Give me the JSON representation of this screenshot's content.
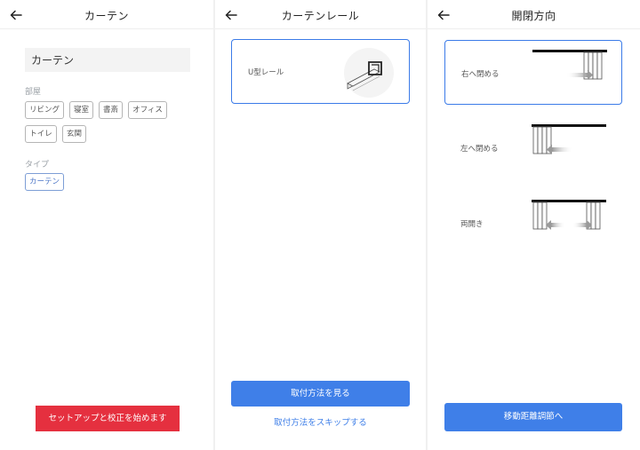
{
  "screen1": {
    "title": "カーテン",
    "name_value": "カーテン",
    "room_label": "部屋",
    "rooms": [
      "リビング",
      "寝室",
      "書斎",
      "オフィス",
      "トイレ",
      "玄関"
    ],
    "type_label": "タイプ",
    "type_selected": "カーテン",
    "start_button": "セットアップと校正を始めます"
  },
  "screen2": {
    "title": "カーテンレール",
    "rail_option": "U型レール",
    "view_method_button": "取付方法を見る",
    "skip_link": "取付方法をスキップする"
  },
  "screen3": {
    "title": "開閉方向",
    "options": [
      "右へ閉める",
      "左へ閉める",
      "両開き"
    ],
    "selected_index": 0,
    "next_button": "移動距離調節へ"
  },
  "colors": {
    "accent_blue": "#3f7fe8",
    "start_red": "#e5303f"
  }
}
